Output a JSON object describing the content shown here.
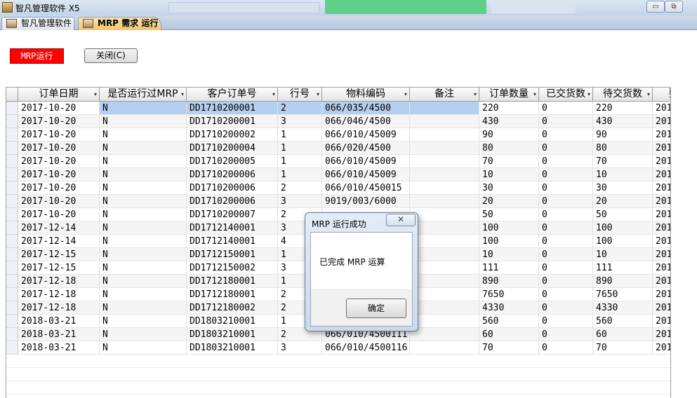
{
  "window": {
    "title": "智凡管理软件 X5",
    "app_icon": "app-icon",
    "minimize_glyph": "▭",
    "restore_glyph": "⧉"
  },
  "tabs": [
    {
      "label": "智凡管理软件",
      "icon": "module-icon",
      "active": false
    },
    {
      "label": "MRP 需求 运行",
      "icon": "module-icon",
      "active": true
    }
  ],
  "toolbar": {
    "run_label": "MRP运行",
    "close_label": "关闭(C)"
  },
  "grid": {
    "columns": [
      "订单日期",
      "是否运行过MRP",
      "客户订单号",
      "行号",
      "物料编码",
      "备注",
      "订单数量",
      "已交货数",
      "待交货数",
      "要"
    ],
    "sort_arrow": "▾",
    "rows": [
      [
        "2017-10-20",
        "N",
        "DD1710200001",
        "2",
        "066/035/4500",
        "",
        "220",
        "0",
        "220",
        "201"
      ],
      [
        "2017-10-20",
        "N",
        "DD1710200001",
        "3",
        "066/046/4500",
        "",
        "430",
        "0",
        "430",
        "201"
      ],
      [
        "2017-10-20",
        "N",
        "DD1710200002",
        "1",
        "066/010/45009",
        "",
        "90",
        "0",
        "90",
        "201"
      ],
      [
        "2017-10-20",
        "N",
        "DD1710200004",
        "1",
        "066/020/4500",
        "",
        "80",
        "0",
        "80",
        "201"
      ],
      [
        "2017-10-20",
        "N",
        "DD1710200005",
        "1",
        "066/010/45009",
        "",
        "70",
        "0",
        "70",
        "201"
      ],
      [
        "2017-10-20",
        "N",
        "DD1710200006",
        "1",
        "066/010/45009",
        "",
        "10",
        "0",
        "10",
        "201"
      ],
      [
        "2017-10-20",
        "N",
        "DD1710200006",
        "2",
        "066/010/450015",
        "",
        "30",
        "0",
        "30",
        "201"
      ],
      [
        "2017-10-20",
        "N",
        "DD1710200006",
        "3",
        "9019/003/6000",
        "",
        "20",
        "0",
        "20",
        "201"
      ],
      [
        "2017-10-20",
        "N",
        "DD1710200007",
        "2",
        "",
        "",
        "50",
        "0",
        "50",
        "201"
      ],
      [
        "2017-12-14",
        "N",
        "DD1712140001",
        "3",
        "",
        "",
        "100",
        "0",
        "100",
        "201"
      ],
      [
        "2017-12-14",
        "N",
        "DD1712140001",
        "4",
        "",
        "",
        "100",
        "0",
        "100",
        "201"
      ],
      [
        "2017-12-15",
        "N",
        "DD1712150001",
        "1",
        "",
        "",
        "10",
        "0",
        "10",
        "201"
      ],
      [
        "2017-12-15",
        "N",
        "DD1712150002",
        "3",
        "",
        "",
        "111",
        "0",
        "111",
        "201"
      ],
      [
        "2017-12-18",
        "N",
        "DD1712180001",
        "1",
        "",
        "",
        "890",
        "0",
        "890",
        "201"
      ],
      [
        "2017-12-18",
        "N",
        "DD1712180001",
        "2",
        "",
        "",
        "7650",
        "0",
        "7650",
        "201"
      ],
      [
        "2017-12-18",
        "N",
        "DD1712180002",
        "2",
        "",
        "",
        "4330",
        "0",
        "4330",
        "201"
      ],
      [
        "2018-03-21",
        "N",
        "DD1803210001",
        "1",
        "",
        "",
        "560",
        "0",
        "560",
        "201"
      ],
      [
        "2018-03-21",
        "N",
        "DD1803210001",
        "2",
        "066/010/4500111",
        "",
        "60",
        "0",
        "60",
        "201"
      ],
      [
        "2018-03-21",
        "N",
        "DD1803210001",
        "3",
        "066/010/4500116",
        "",
        "70",
        "0",
        "70",
        "201"
      ]
    ]
  },
  "dialog": {
    "title": "MRP 运行成功",
    "close_glyph": "✕",
    "message": "已完成 MRP 运算",
    "ok_label": "确定"
  }
}
